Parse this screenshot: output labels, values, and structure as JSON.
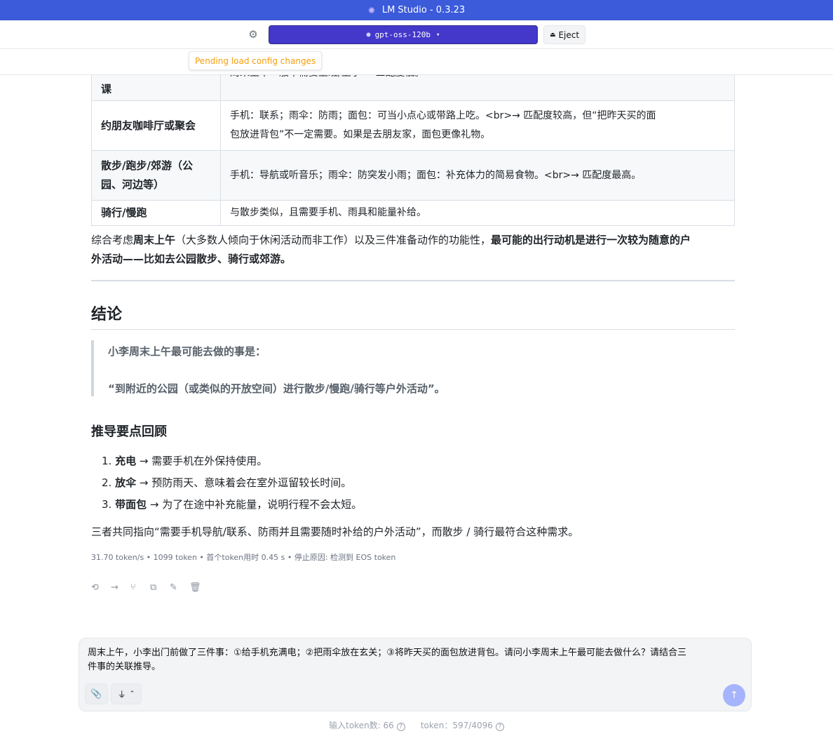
{
  "app": {
    "title": "LM Studio - 0.3.23"
  },
  "toolbar": {
    "model_name": "gpt-oss-120b",
    "eject_label": "Eject"
  },
  "pending": {
    "label": "Pending load config changes"
  },
  "table": {
    "rows": [
      {
        "scenario": "课",
        "analysis": "周末上午一般不需要上班/上学 → 匹配度低。"
      },
      {
        "scenario": "约朋友咖啡厅或聚会",
        "analysis_line1": "手机：联系；雨伞：防雨；面包：可当小点心或带路上吃。<br>→ 匹配度较高，但“把昨天买的面",
        "analysis_line2": "包放进背包”不一定需要。如果是去朋友家，面包更像礼物。"
      },
      {
        "scenario_line1": "散步/跑步/郊游（公",
        "scenario_line2": "园、河边等）",
        "analysis": "手机：导航或听音乐；雨伞：防突发小雨；面包：补充体力的简易食物。<br>→ 匹配度最高。"
      },
      {
        "scenario": "骑行/慢跑",
        "analysis": "与散步类似，且需要手机、雨具和能量补给。"
      }
    ]
  },
  "summary": {
    "prefix": "综合考虑",
    "bold1": "周末上午",
    "middle": "（大多数人倾向于休闲活动而非工作）以及三件准备动作的功能性，",
    "bold2_line1": "最可能的出行动机是进行一次较为随意的户",
    "bold2_line2": "外活动——比如去公园散步、骑行或郊游。"
  },
  "conclusion": {
    "heading": "结论",
    "quote_line1": "小李周末上午最可能去做的事是：",
    "quote_line2": "“到附近的公园（或类似的开放空间）进行散步/慢跑/骑行等户外活动”。"
  },
  "recap": {
    "heading": "推导要点回顾",
    "items": [
      {
        "num": "1.",
        "key": "充电",
        "text": " → 需要手机在外保持使用。"
      },
      {
        "num": "2.",
        "key": "放伞",
        "text": " → 预防雨天、意味着会在室外逗留较长时间。"
      },
      {
        "num": "3.",
        "key": "带面包",
        "text": " → 为了在途中补充能量，说明行程不会太短。"
      }
    ],
    "closing": "三者共同指向“需要手机导航/联系、防雨并且需要随时补给的户外活动”，而散步 / 骑行最符合这种需求。"
  },
  "stats": {
    "text": "31.70 token/s • 1099 token • 首个token用时 0.45 s • 停止原因: 检测到 EOS token"
  },
  "composer": {
    "line1": "周末上午，小李出门前做了三件事：①给手机充满电；②把雨伞放在玄关；③将昨天买的面包放进背包。请问小李周末上午最可能去做什么？请结合三",
    "line2": "件事的关联推导。"
  },
  "footer": {
    "input_tokens": "输入token数: 66",
    "context_tokens": "token：597/4096"
  },
  "colors": {
    "titlebar": "#3b5bdb",
    "model_button": "#4338ca",
    "pending_text": "#f59e0b",
    "send_button": "#a5b4fc"
  },
  "icons": [
    "gear-icon",
    "model-icon",
    "chevron-down-icon",
    "eject-icon",
    "regenerate-icon",
    "continue-icon",
    "branch-icon",
    "copy-icon",
    "edit-icon",
    "delete-icon",
    "paperclip-icon",
    "plug-icon",
    "chevron-up-icon",
    "send-arrow-icon",
    "help-icon"
  ]
}
